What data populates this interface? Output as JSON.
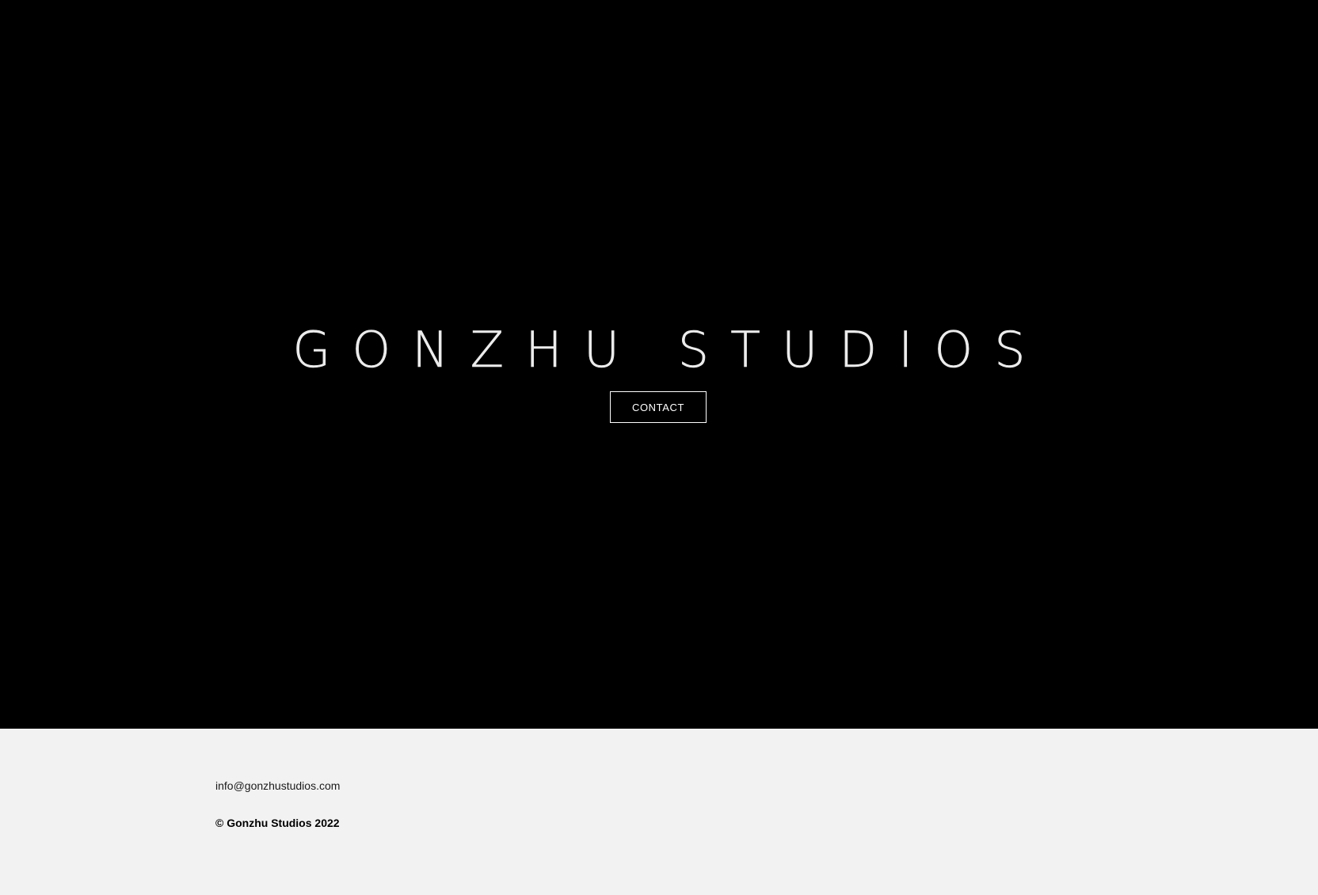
{
  "hero": {
    "title": "GONZHU STUDIOS",
    "contact_label": "CONTACT"
  },
  "footer": {
    "email": "info@gonzhustudios.com",
    "copyright": "© Gonzhu Studios 2022"
  },
  "colors": {
    "hero_background": "#000000",
    "title_text": "#ececec",
    "footer_background": "#f2f2f2",
    "footer_text": "#000000"
  }
}
